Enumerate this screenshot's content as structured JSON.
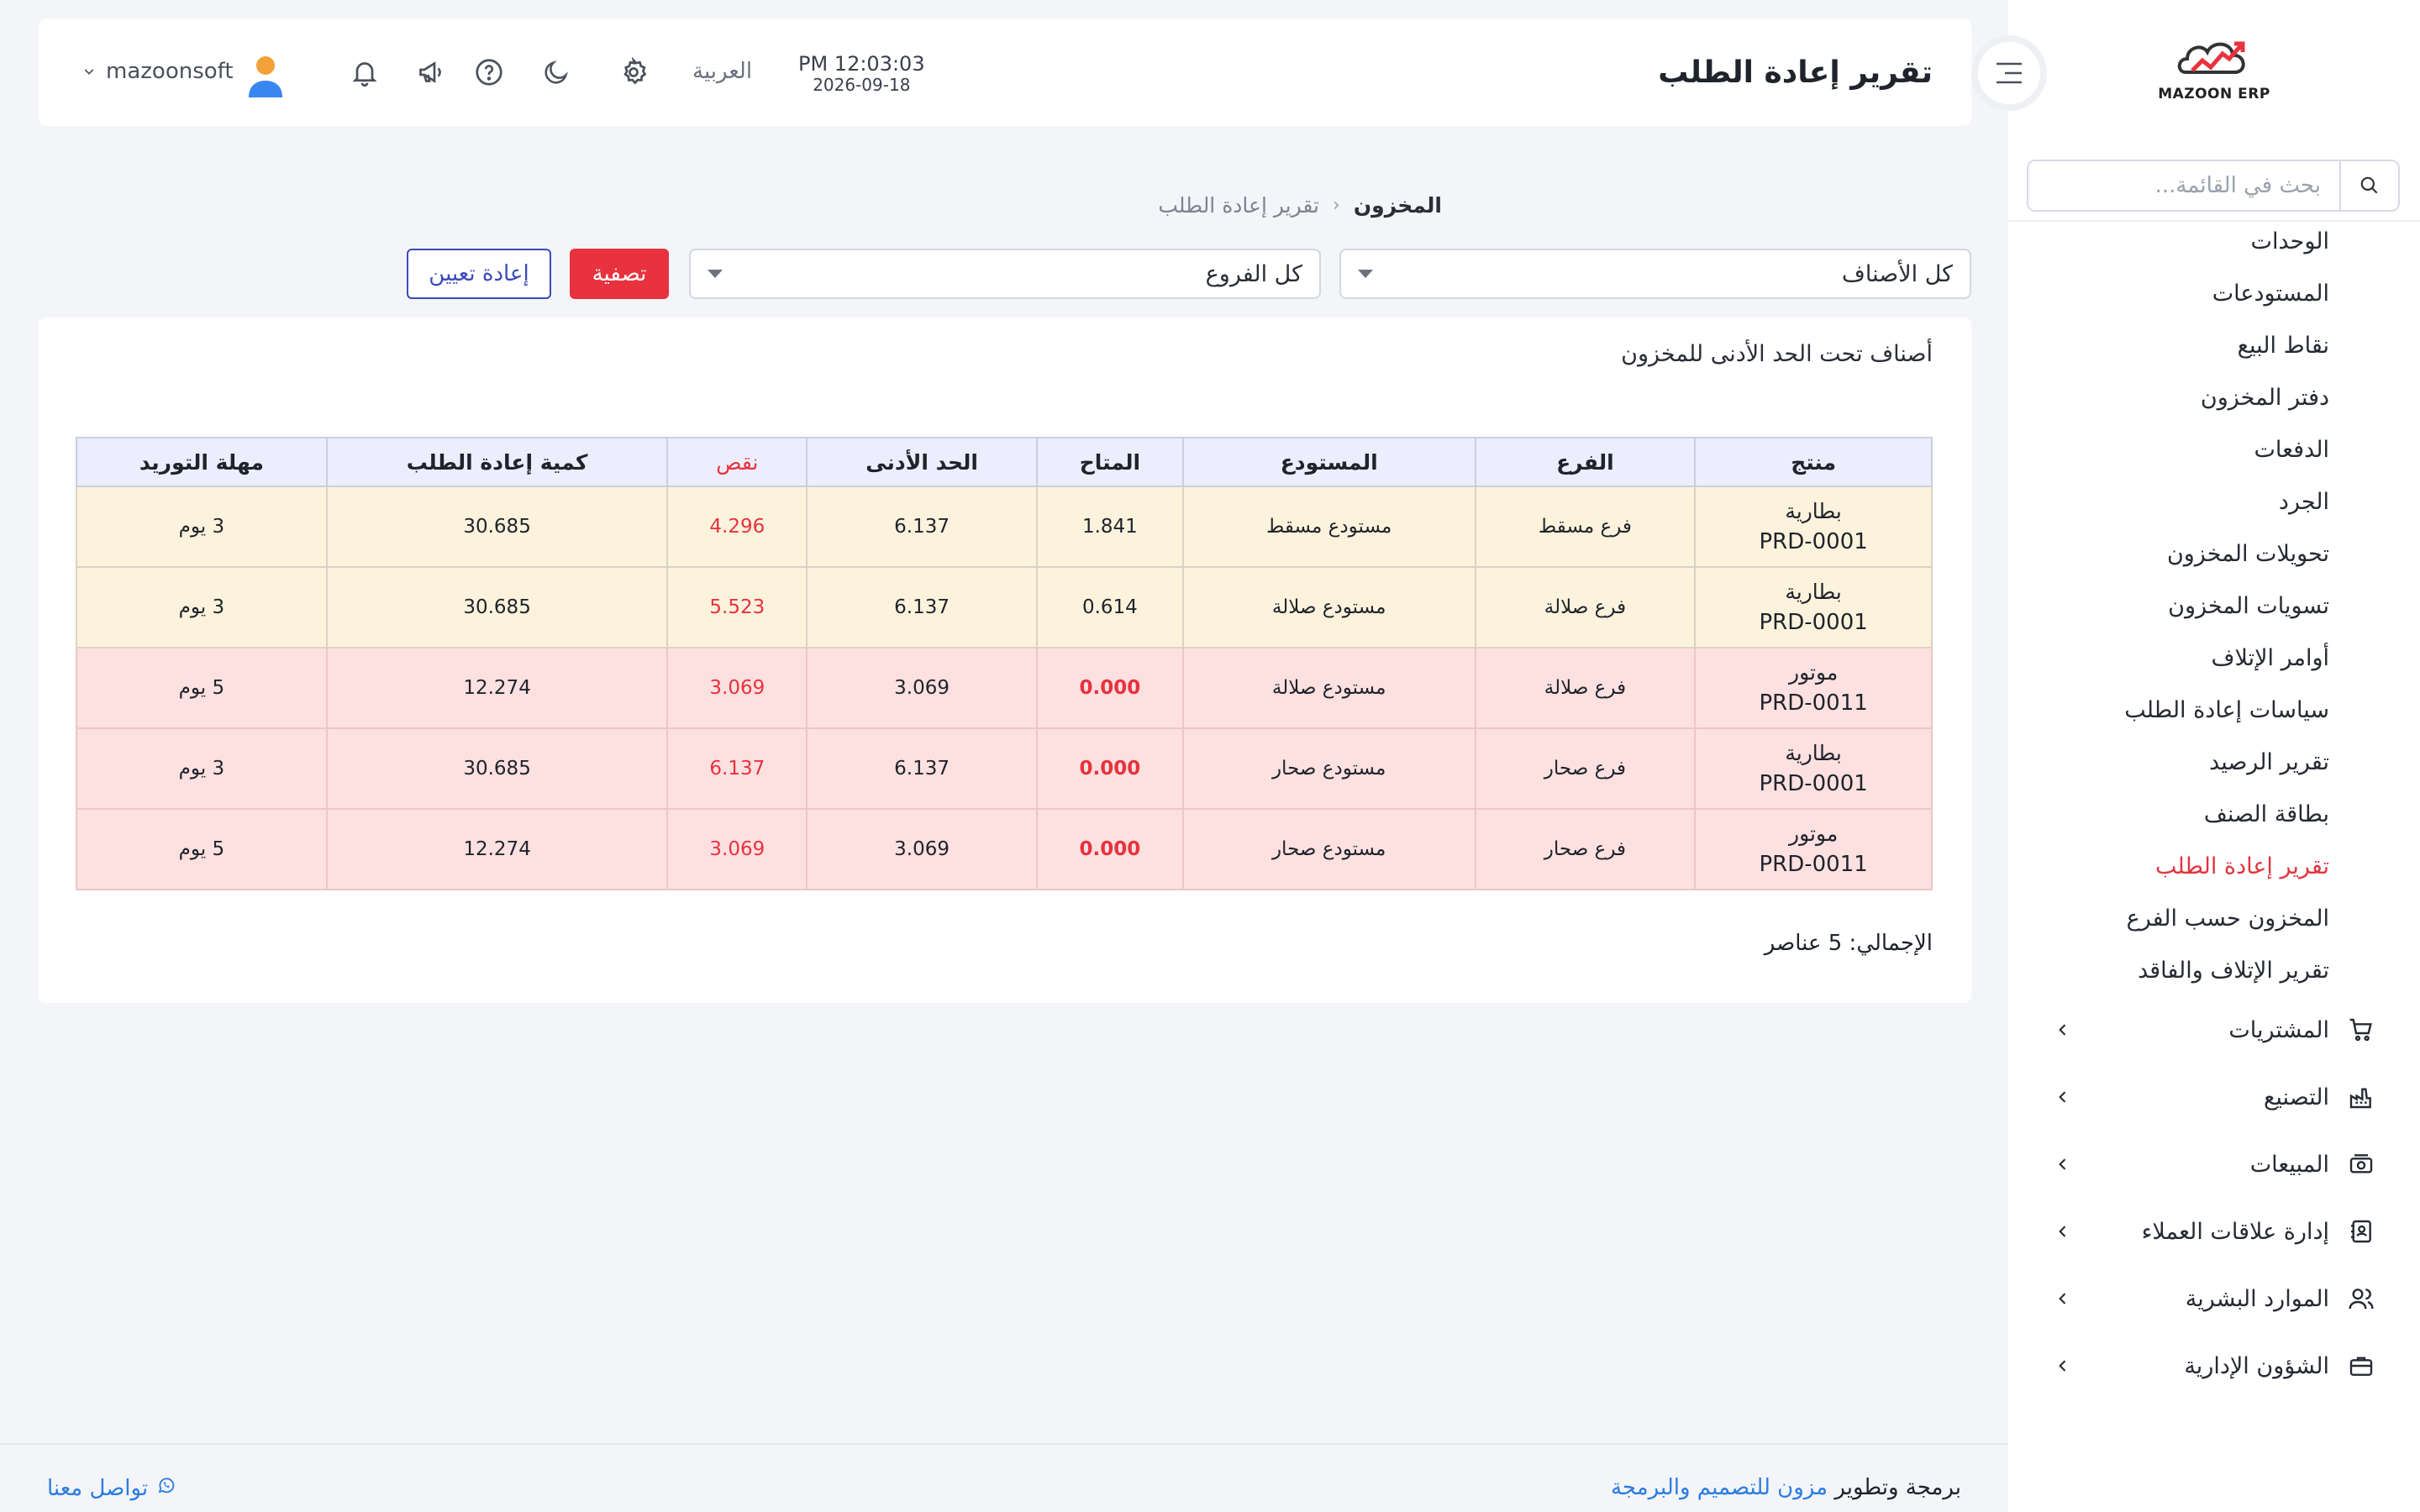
{
  "app": {
    "name": "MAZOON ERP",
    "logo_sub": "ERP_HUB"
  },
  "header": {
    "title": "تقرير إعادة الطلب",
    "time": "PM 12:03:03",
    "date": "2026-09-18",
    "language": "العربية",
    "username": "mazoonsoft"
  },
  "sidebar": {
    "search_placeholder": "بحث في القائمة...",
    "sub_items": [
      {
        "label": "الوحدات"
      },
      {
        "label": "المستودعات"
      },
      {
        "label": "نقاط البيع"
      },
      {
        "label": "دفتر المخزون"
      },
      {
        "label": "الدفعات"
      },
      {
        "label": "الجرد"
      },
      {
        "label": "تحويلات المخزون"
      },
      {
        "label": "تسويات المخزون"
      },
      {
        "label": "أوامر الإتلاف"
      },
      {
        "label": "سياسات إعادة الطلب"
      },
      {
        "label": "تقرير الرصيد"
      },
      {
        "label": "بطاقة الصنف"
      },
      {
        "label": "تقرير إعادة الطلب",
        "active": true
      },
      {
        "label": "المخزون حسب الفرع"
      },
      {
        "label": "تقرير الإتلاف والفاقد"
      }
    ],
    "modules": [
      {
        "label": "المشتريات",
        "icon": "cart-icon"
      },
      {
        "label": "التصنيع",
        "icon": "factory-icon"
      },
      {
        "label": "المبيعات",
        "icon": "cash-register-icon"
      },
      {
        "label": "إدارة علاقات العملاء",
        "icon": "contacts-book-icon"
      },
      {
        "label": "الموارد البشرية",
        "icon": "users-icon"
      },
      {
        "label": "الشؤون الإدارية",
        "icon": "briefcase-icon"
      }
    ]
  },
  "breadcrumb": {
    "root": "المخزون",
    "separator": "‹",
    "current": "تقرير إعادة الطلب"
  },
  "filters": {
    "category_value": "كل الأصناف",
    "branch_value": "كل الفروع",
    "filter_label": "تصفية",
    "reset_label": "إعادة تعيين"
  },
  "report": {
    "title": "أصناف تحت الحد الأدنى للمخزون",
    "columns": [
      "منتج",
      "الفرع",
      "المستودع",
      "المتاح",
      "الحد الأدنى",
      "نقص",
      "كمية إعادة الطلب",
      "مهلة التوريد"
    ],
    "rows": [
      {
        "name": "بطارية",
        "code": "PRD-0001",
        "branch": "فرع مسقط",
        "warehouse": "مستودع مسقط",
        "available": "1.841",
        "minimum": "6.137",
        "shortage": "4.296",
        "reorder_qty": "30.685",
        "lead_time": "3 يوم"
      },
      {
        "name": "بطارية",
        "code": "PRD-0001",
        "branch": "فرع صلالة",
        "warehouse": "مستودع صلالة",
        "available": "0.614",
        "minimum": "6.137",
        "shortage": "5.523",
        "reorder_qty": "30.685",
        "lead_time": "3 يوم"
      },
      {
        "name": "موتور",
        "code": "PRD-0011",
        "branch": "فرع صلالة",
        "warehouse": "مستودع صلالة",
        "available": "0.000",
        "minimum": "3.069",
        "shortage": "3.069",
        "reorder_qty": "12.274",
        "lead_time": "5 يوم"
      },
      {
        "name": "بطارية",
        "code": "PRD-0001",
        "branch": "فرع صحار",
        "warehouse": "مستودع صحار",
        "available": "0.000",
        "minimum": "6.137",
        "shortage": "6.137",
        "reorder_qty": "30.685",
        "lead_time": "3 يوم"
      },
      {
        "name": "موتور",
        "code": "PRD-0011",
        "branch": "فرع صحار",
        "warehouse": "مستودع صحار",
        "available": "0.000",
        "minimum": "3.069",
        "shortage": "3.069",
        "reorder_qty": "12.274",
        "lead_time": "5 يوم"
      }
    ],
    "total": "الإجمالي: 5 عناصر"
  },
  "footer": {
    "credit_prefix": "برمجة وتطوير",
    "credit_link": "مزون للتصميم والبرمجة",
    "contact": "تواصل معنا"
  },
  "colors": {
    "accent_red": "#e8323e",
    "reset_blue": "#3b4bb8",
    "warn_row": "#fdf3dd",
    "critical_row": "#fde0e0",
    "link_blue": "#2a7de1"
  }
}
